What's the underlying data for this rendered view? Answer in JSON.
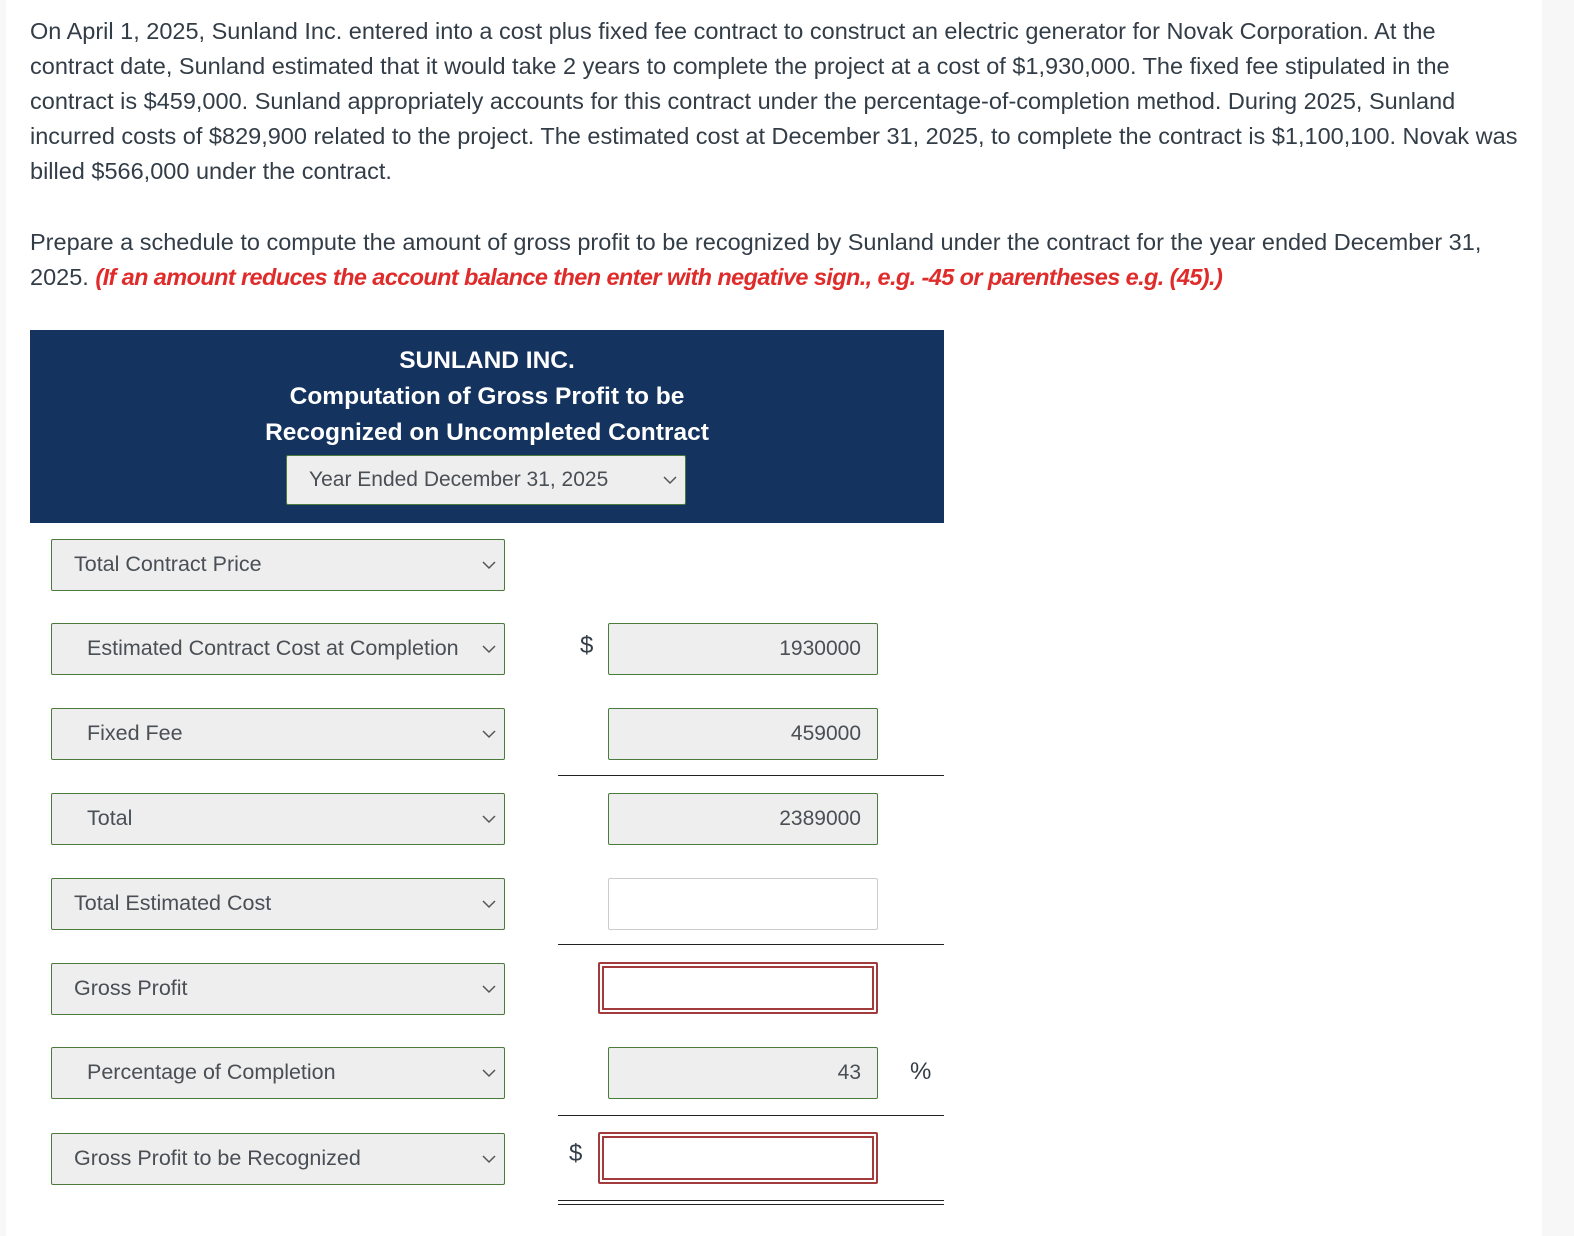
{
  "problem": {
    "text": "On April 1, 2025, Sunland Inc. entered into a cost plus fixed fee contract to construct an electric generator for Novak Corporation. At the contract date, Sunland estimated that it would take 2 years to complete the project at a cost of $1,930,000. The fixed fee stipulated in the contract is $459,000. Sunland appropriately accounts for this contract under the percentage-of-completion method. During 2025, Sunland incurred costs of $829,900 related to the project. The estimated cost at December 31, 2025, to complete the contract is $1,100,100. Novak was billed $566,000 under the contract."
  },
  "instructions": {
    "text": "Prepare a schedule to compute the amount of gross profit to be recognized by Sunland under the contract for the year ended December 31, 2025.",
    "hint": "(If an amount reduces the account balance then enter with negative sign., e.g. -45 or parentheses e.g. (45).)"
  },
  "schedule_header": {
    "company": "SUNLAND INC.",
    "title_line1": "Computation of Gross Profit to be",
    "title_line2": "Recognized on Uncompleted Contract",
    "period_select": "Year Ended December 31, 2025"
  },
  "rows": [
    {
      "label": "Total Contract Price",
      "currency": "",
      "value": null,
      "state": "none"
    },
    {
      "label": "Estimated Contract Cost at Completion",
      "currency": "$",
      "value": "1930000",
      "state": "filled"
    },
    {
      "label": "Fixed Fee",
      "currency": "",
      "value": "459000",
      "state": "filled"
    },
    {
      "label": "Total",
      "currency": "",
      "value": "2389000",
      "state": "filled"
    },
    {
      "label": "Total Estimated Cost",
      "currency": "",
      "value": "",
      "state": "empty"
    },
    {
      "label": "Gross Profit",
      "currency": "",
      "value": "",
      "state": "error"
    },
    {
      "label": "Percentage of Completion",
      "currency": "",
      "value": "43",
      "state": "filled",
      "suffix": "%"
    },
    {
      "label": "Gross Profit to be Recognized",
      "currency": "$",
      "value": "",
      "state": "error"
    }
  ],
  "colors": {
    "header_bg": "#14335f",
    "hint_red": "#e02b2b",
    "field_border_green": "#4a7a3c",
    "error_border_red": "#a23b3b"
  }
}
